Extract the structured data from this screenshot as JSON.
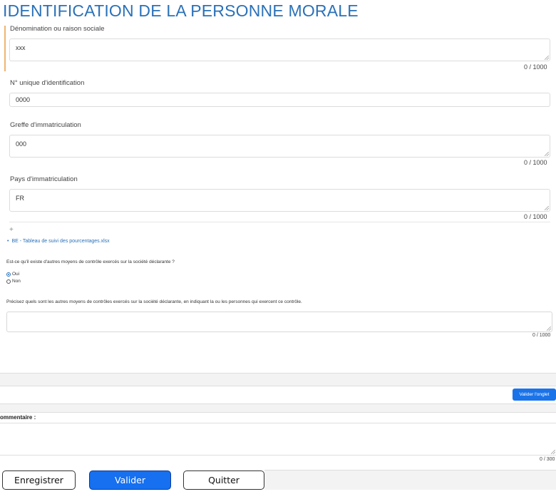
{
  "page_title": "IDENTIFICATION DE LA PERSONNE MORALE",
  "fields": {
    "denomination": {
      "label": "Dénomination ou raison sociale",
      "value": "xxx",
      "counter": "0 / 1000"
    },
    "identification": {
      "label": "N° unique d'identification",
      "value": "0000"
    },
    "greffe": {
      "label": "Greffe d'immatriculation",
      "value": "000",
      "counter": "0 / 1000"
    },
    "pays": {
      "label": "Pays d'immatriculation",
      "value": "FR",
      "counter": "0 / 1000"
    }
  },
  "plus_sign": "+",
  "attachment": {
    "name": "BE - Tableau de suivi des pourcentages.xlsx"
  },
  "question": {
    "text": "Est-ce qu'il existe d'autres moyens de contrôle exercés sur la société déclarante ?",
    "options": [
      {
        "label": "Oui",
        "checked": true
      },
      {
        "label": "Non",
        "checked": false
      }
    ]
  },
  "precision": {
    "text": "Précisez quels sont les autres moyens de contrôles exercés sur la société déclarante, en indiquant la ou les personnes qui exercent ce contrôle.",
    "counter": "0 / 1000"
  },
  "validate_tab_label": "Valider l'onglet",
  "comment": {
    "label": "ommentaire :",
    "counter": "0 / 300"
  },
  "footer": {
    "save_label": "Enregistrer",
    "validate_label": "Valider",
    "quit_label": "Quitter"
  },
  "colors": {
    "accent_blue": "#2a71b8",
    "button_blue": "#1670ef",
    "left_marker": "#f0b46e"
  }
}
